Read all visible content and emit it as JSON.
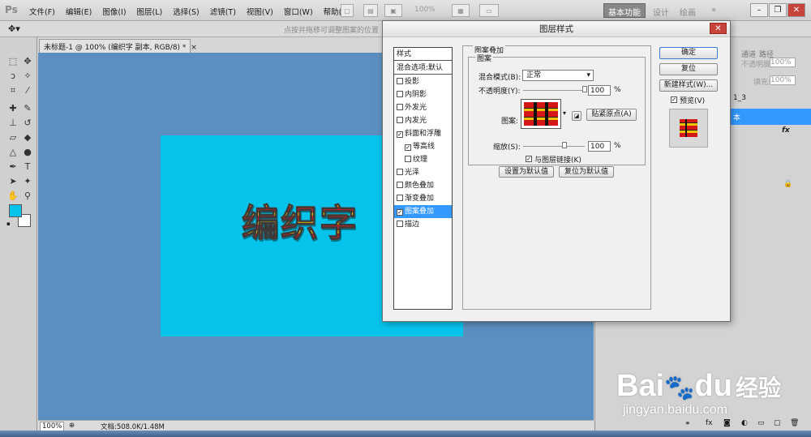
{
  "app": {
    "logo": "Ps"
  },
  "menu": [
    "文件(F)",
    "编辑(E)",
    "图像(I)",
    "图层(L)",
    "选择(S)",
    "滤镜(T)",
    "视图(V)",
    "窗口(W)",
    "帮助(H)"
  ],
  "appbar": {
    "zoom": "100%",
    "workspace": "基本功能",
    "ws_items": [
      "设计",
      "绘画"
    ],
    "more": "»"
  },
  "options_hint": "点按并拖移可调整图案的位置",
  "document": {
    "tab": "未标题-1 @ 100% (编织字 副本, RGB/8) *",
    "close": "×",
    "text": "编织字",
    "status_zoom": "100%",
    "status_doc": "文档:508.0K/1.48M"
  },
  "colors": {
    "workspace_bg": "#5b8fbf",
    "canvas": "#06c3ec",
    "fg_swatch": "#06c3ec",
    "bg_swatch": "#ffffff",
    "selected": "#3399ff"
  },
  "dialog": {
    "title": "图层样式",
    "close": "✕",
    "style_list": [
      {
        "label": "样式",
        "type": "header"
      },
      {
        "label": "混合选项:默认",
        "type": "header"
      },
      {
        "label": "投影",
        "checked": false
      },
      {
        "label": "内阴影",
        "checked": false
      },
      {
        "label": "外发光",
        "checked": false
      },
      {
        "label": "内发光",
        "checked": false
      },
      {
        "label": "斜面和浮雕",
        "checked": true
      },
      {
        "label": "等高线",
        "checked": true,
        "indent": true
      },
      {
        "label": "纹理",
        "checked": false,
        "indent": true
      },
      {
        "label": "光泽",
        "checked": false
      },
      {
        "label": "颜色叠加",
        "checked": false
      },
      {
        "label": "渐变叠加",
        "checked": false
      },
      {
        "label": "图案叠加",
        "checked": true,
        "selected": true
      },
      {
        "label": "描边",
        "checked": false
      }
    ],
    "section_title": "图案叠加",
    "group_title": "图案",
    "blend_mode_label": "混合模式(B):",
    "blend_mode": "正常",
    "opacity_label": "不透明度(Y):",
    "opacity": 100,
    "opacity_text": "100",
    "percent": "%",
    "pattern_label": "图案:",
    "snap_button": "贴紧原点(A)",
    "scale_label": "缩放(S):",
    "scale": 100,
    "scale_text": "100",
    "link_label": "与图层链接(K)",
    "link_checked": true,
    "set_default": "设置为默认值",
    "reset_default": "复位为默认值",
    "ok": "确定",
    "reset": "复位",
    "new_style": "新建样式(W)...",
    "preview_label": "预览(V)",
    "preview_checked": true
  },
  "panel": {
    "lock_opacity": "不透明度:",
    "opacity_val": "100%",
    "fill_label": "填充:",
    "fill_val": "100%",
    "tabs": [
      "通道",
      "路径"
    ],
    "layer1": "1_3",
    "layer2": "本",
    "fx": "fx"
  },
  "watermark": {
    "brand": "Bai",
    "du": "du",
    "cn": "经验",
    "url": "jingyan.baidu.com"
  }
}
